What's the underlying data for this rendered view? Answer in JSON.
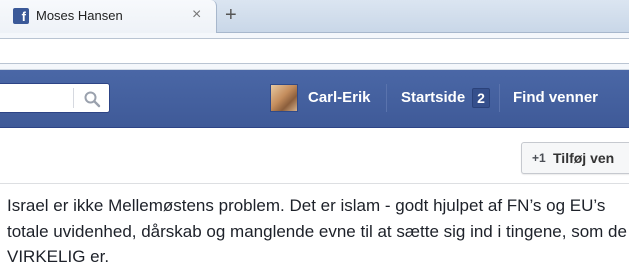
{
  "browser": {
    "tab_title": "Moses Hansen",
    "tab_close": "×",
    "new_tab": "+"
  },
  "header": {
    "search": {
      "placeholder": "",
      "value": ""
    },
    "user_name": "Carl-Erik",
    "home_label": "Startside",
    "home_count": "2",
    "find_friends_label": "Find venner",
    "brand_color": "#3b5998"
  },
  "profile_actions": {
    "add_friend_icon": "+1",
    "add_friend_label": "Tilføj ven"
  },
  "post": {
    "text": "Israel er ikke Mellemøstens problem. Det er islam - godt hjulpet af FN’s og EU’s totale uvidenhed, dårskab og manglende evne til at sætte sig ind i tingene, som de VIRKELIG er."
  }
}
